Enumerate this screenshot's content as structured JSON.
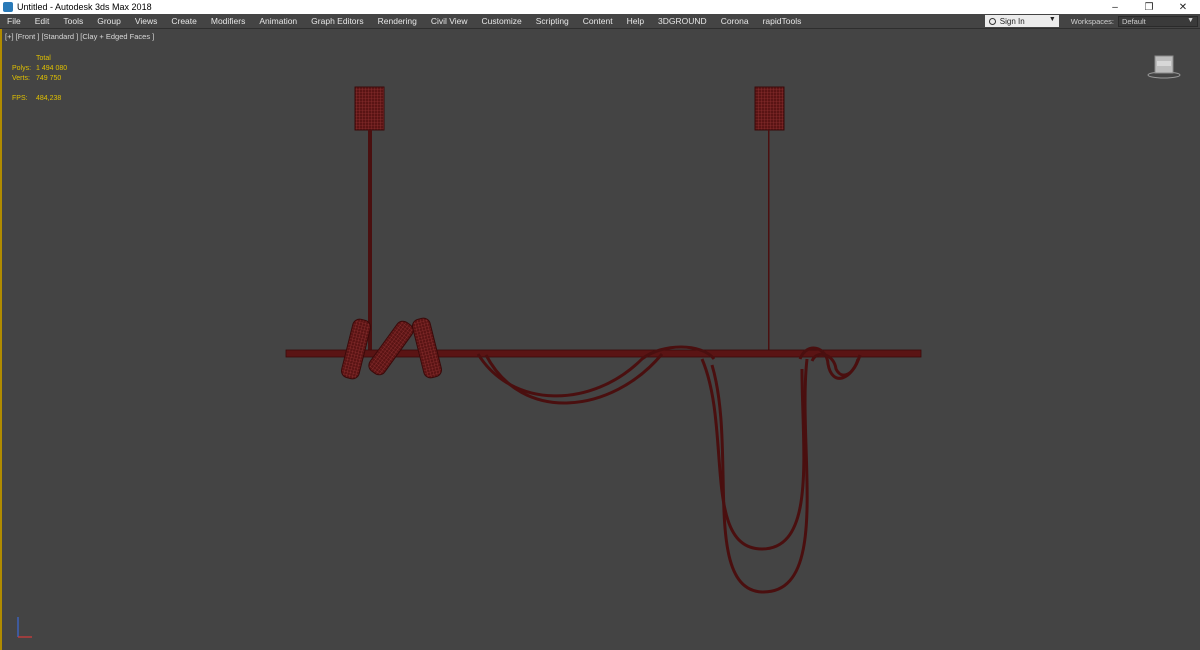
{
  "window": {
    "title": "Untitled - Autodesk 3ds Max 2018",
    "controls": [
      "–",
      "❐",
      "✕"
    ]
  },
  "menu": {
    "items": [
      "File",
      "Edit",
      "Tools",
      "Group",
      "Views",
      "Create",
      "Modifiers",
      "Animation",
      "Graph Editors",
      "Rendering",
      "Civil View",
      "Customize",
      "Scripting",
      "Content",
      "Help",
      "3DGROUND",
      "Corona",
      "rapidTools"
    ],
    "sign_in": "Sign In",
    "workspaces_label": "Workspaces:",
    "workspaces_value": "Default"
  },
  "viewport": {
    "label": "[+] [Front ] [Standard ] [Clay + Edged Faces ]",
    "stats": {
      "total_label": "Total",
      "polys_label": "Polys:",
      "polys_value": "1 494 080",
      "verts_label": "Verts:",
      "verts_value": "749 750",
      "fps_label": "FPS:",
      "fps_value": "484,238"
    }
  },
  "colors": {
    "viewport_bg": "#444444",
    "model": "#5a1414",
    "model_wire": "#8a2a2a",
    "stats_text": "#e0c000",
    "active_border": "#b08b00"
  },
  "icons": {
    "app": "3dsmax-icon",
    "user": "user-icon",
    "viewcube": "viewcube-icon",
    "axis": "axis-tripod-icon"
  }
}
